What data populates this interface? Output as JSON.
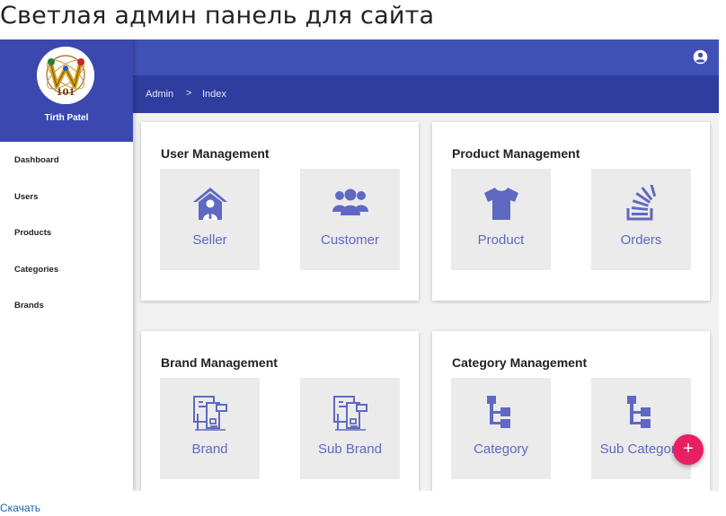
{
  "page_heading": "Светлая админ панель для сайта",
  "download_link": "Скачать",
  "colors": {
    "primary": "#3f51b5",
    "primary_dark": "#2f3d9e",
    "accent": "#e91e63",
    "icon": "#5f69c2"
  },
  "sidebar": {
    "user_name": "Tirth Patel",
    "logo_text": "101",
    "items": [
      {
        "label": "Dashboard"
      },
      {
        "label": "Users"
      },
      {
        "label": "Products"
      },
      {
        "label": "Categories"
      },
      {
        "label": "Brands"
      }
    ]
  },
  "header": {
    "account_icon": "account-circle-icon"
  },
  "breadcrumb": {
    "root": "Admin",
    "separator": ">",
    "current": "Index"
  },
  "cards": [
    {
      "title": "User Management",
      "tiles": [
        {
          "label": "Seller",
          "icon": "house-person-icon"
        },
        {
          "label": "Customer",
          "icon": "users-group-icon"
        }
      ]
    },
    {
      "title": "Product Management",
      "tiles": [
        {
          "label": "Product",
          "icon": "tshirt-icon"
        },
        {
          "label": "Orders",
          "icon": "stack-icon"
        }
      ]
    },
    {
      "title": "Brand Management",
      "tiles": [
        {
          "label": "Brand",
          "icon": "brand-docs-icon"
        },
        {
          "label": "Sub Brand",
          "icon": "brand-docs-icon"
        }
      ]
    },
    {
      "title": "Category Management",
      "tiles": [
        {
          "label": "Category",
          "icon": "sitemap-icon"
        },
        {
          "label": "Sub Category",
          "icon": "sitemap-icon"
        }
      ]
    }
  ],
  "fab": {
    "label": "+"
  }
}
